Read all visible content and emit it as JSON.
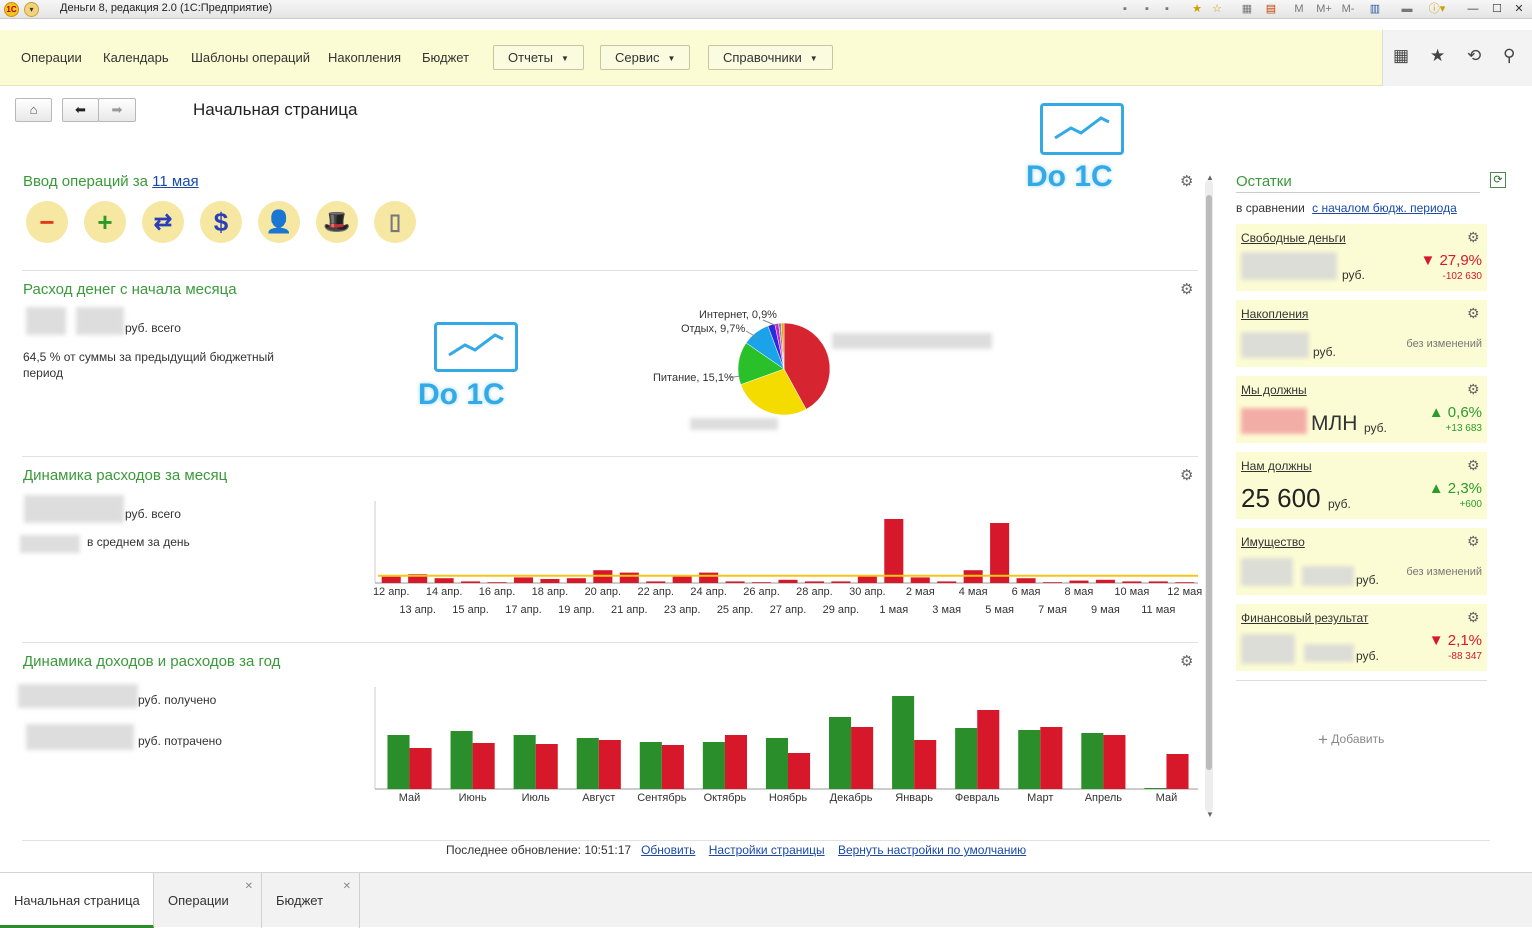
{
  "window": {
    "title": "Деньги 8, редакция 2.0  (1С:Предприятие)"
  },
  "menu": {
    "items": [
      "Операции",
      "Календарь",
      "Шаблоны операций",
      "Накопления",
      "Бюджет"
    ],
    "dropdowns": [
      "Отчеты",
      "Сервис",
      "Справочники"
    ]
  },
  "page": {
    "title": "Начальная страница"
  },
  "watermark": "Do 1C",
  "entry": {
    "title": "Ввод операций за",
    "date_link": "11 мая",
    "buttons": [
      "minus-button",
      "plus-button",
      "transfer-button",
      "dollar-button",
      "person-button",
      "top-hat-button",
      "document-button"
    ]
  },
  "spend": {
    "title": "Расход денег с начала месяца",
    "total_suffix": "руб. всего",
    "percent_text": "64,5 % от суммы за предыдущий бюджетный период",
    "pie_labels": [
      "Интернет, 0,9%",
      "Отдых, 9,7%",
      "Питание, 15,1%"
    ]
  },
  "monthly": {
    "title": "Динамика расходов за месяц",
    "total_suffix": "руб. всего",
    "avg_suffix": "в среднем за день"
  },
  "yearly": {
    "title": "Динамика доходов и расходов за год",
    "received_suffix": "руб. получено",
    "spent_suffix": "руб. потрачено"
  },
  "footer": {
    "last_update_label": "Последнее обновление:",
    "time": "10:51:17",
    "refresh": "Обновить",
    "settings": "Настройки страницы",
    "reset": "Вернуть настройки по умолчанию"
  },
  "balances": {
    "title": "Остатки",
    "compare_label": "в сравнении",
    "compare_link": "с началом бюдж. периода",
    "add_label": "Добавить",
    "cards": [
      {
        "name": "Свободные деньги",
        "currency": "руб.",
        "change": "▼ 27,9%",
        "delta": "-102 630",
        "trend": "down"
      },
      {
        "name": "Накопления",
        "currency": "руб.",
        "nochange": "без изменений"
      },
      {
        "name": "Мы должны",
        "amount": "МЛН",
        "currency": "руб.",
        "change": "▲ 0,6%",
        "delta": "+13 683",
        "trend": "up"
      },
      {
        "name": "Нам должны",
        "amount": "25 600",
        "currency": "руб.",
        "change": "▲ 2,3%",
        "delta": "+600",
        "trend": "up"
      },
      {
        "name": "Имущество",
        "currency": "руб.",
        "nochange": "без изменений"
      },
      {
        "name": "Финансовый результат",
        "currency": "руб.",
        "change": "▼ 2,1%",
        "delta": "-88 347",
        "trend": "down"
      }
    ]
  },
  "tabs": [
    "Начальная страница",
    "Операции",
    "Бюджет"
  ],
  "colors": {
    "accent_green": "#3a9a3a",
    "bar_red": "#d7182a",
    "bar_green": "#2a8f2a",
    "avg_line": "#f5c518",
    "panel_yellow": "#fcfcd4"
  },
  "chart_data": [
    {
      "type": "pie",
      "title": "",
      "slices": [
        {
          "label": "",
          "value": 42.0,
          "color": "#d62530"
        },
        {
          "label": "",
          "value": 27.5,
          "color": "#f5dc00"
        },
        {
          "label": "Питание, 15,1%",
          "value": 15.1,
          "color": "#2ac02a"
        },
        {
          "label": "Отдых, 9,7%",
          "value": 9.7,
          "color": "#1aa3e8"
        },
        {
          "label": "",
          "value": 2.5,
          "color": "#2a2ae0"
        },
        {
          "label": "",
          "value": 1.3,
          "color": "#d020d0"
        },
        {
          "label": "Интернет, 0,9%",
          "value": 0.9,
          "color": "#8a8a8a"
        },
        {
          "label": "",
          "value": 1.0,
          "color": "#e8a020"
        }
      ]
    },
    {
      "type": "bar",
      "title": "",
      "categories": [
        "12 апр.",
        "13 апр.",
        "14 апр.",
        "15 апр.",
        "16 апр.",
        "17 апр.",
        "18 апр.",
        "19 апр.",
        "20 апр.",
        "21 апр.",
        "22 апр.",
        "23 апр.",
        "24 апр.",
        "25 апр.",
        "26 апр.",
        "27 апр.",
        "28 апр.",
        "29 апр.",
        "30 апр.",
        "1 мая",
        "2 мая",
        "3 мая",
        "4 мая",
        "5 мая",
        "6 мая",
        "7 мая",
        "8 мая",
        "9 мая",
        "10 мая",
        "11 мая",
        "12 мая"
      ],
      "values": [
        8,
        11,
        6,
        2,
        1,
        7,
        5,
        6,
        16,
        13,
        2,
        9,
        13,
        2,
        1,
        4,
        2,
        2,
        10,
        80,
        7,
        2,
        16,
        75,
        6,
        1,
        3,
        4,
        2,
        2,
        1
      ],
      "avg_line": 9,
      "ylim": [
        0,
        100
      ]
    },
    {
      "type": "bar",
      "title": "",
      "categories": [
        "Май",
        "Июнь",
        "Июль",
        "Август",
        "Сентябрь",
        "Октябрь",
        "Ноябрь",
        "Декабрь",
        "Январь",
        "Февраль",
        "Март",
        "Апрель",
        "Май"
      ],
      "series": [
        {
          "name": "",
          "values": [
            54,
            58,
            54,
            51,
            47,
            47,
            51,
            72,
            93,
            61,
            59,
            56,
            1
          ]
        },
        {
          "name": "",
          "values": [
            41,
            46,
            45,
            49,
            44,
            54,
            36,
            62,
            49,
            79,
            62,
            54,
            35
          ]
        }
      ],
      "ylim": [
        0,
        100
      ]
    }
  ]
}
